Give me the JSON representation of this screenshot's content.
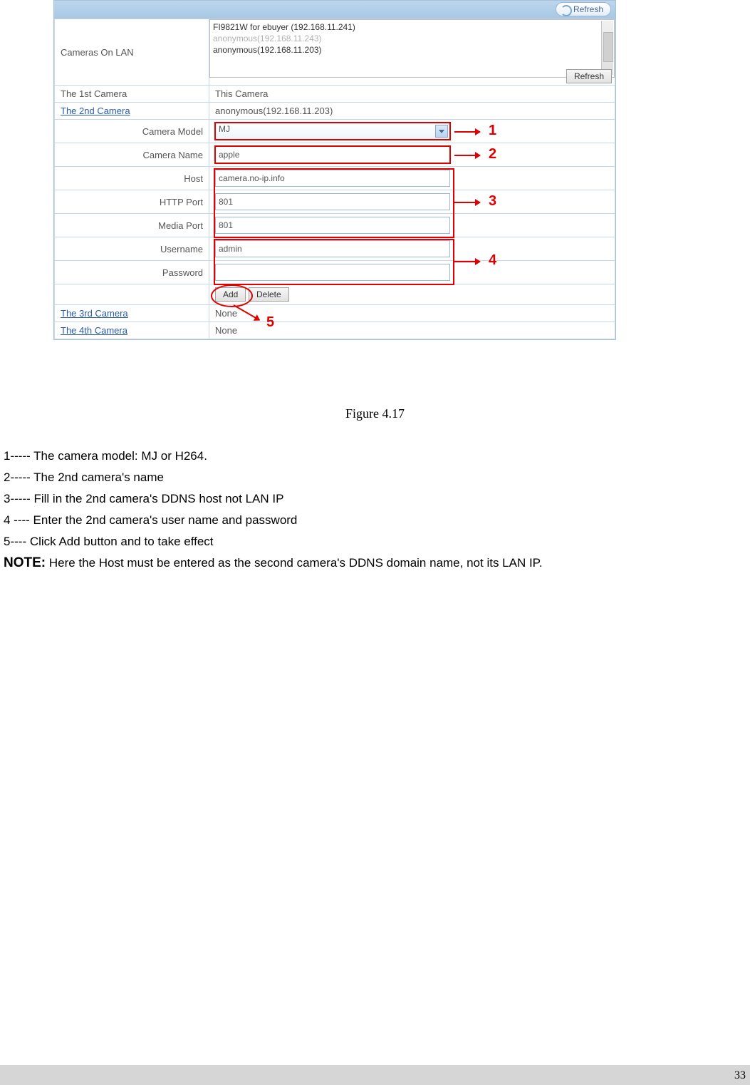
{
  "buttons": {
    "refresh_top": "Refresh",
    "refresh_inline": "Refresh",
    "add": "Add",
    "delete": "Delete"
  },
  "rows": {
    "cameras_on_lan": "Cameras On LAN",
    "first_cam_lbl": "The 1st Camera",
    "first_cam_val": "This Camera",
    "second_cam_lbl": "The 2nd Camera",
    "second_cam_val": "anonymous(192.168.11.203)",
    "third_cam_lbl": "The 3rd Camera",
    "third_cam_val": "None",
    "fourth_cam_lbl": "The 4th Camera",
    "fourth_cam_val": "None"
  },
  "cam_list": {
    "line1": "FI9821W for ebuyer (192.168.11.241)",
    "line2": "anonymous(192.168.11.243)",
    "line3": "anonymous(192.168.11.203)"
  },
  "form": {
    "camera_model_lbl": "Camera Model",
    "camera_model_val": "MJ",
    "camera_name_lbl": "Camera Name",
    "camera_name_val": "apple",
    "host_lbl": "Host",
    "host_val": "camera.no-ip.info",
    "http_port_lbl": "HTTP Port",
    "http_port_val": "801",
    "media_port_lbl": "Media Port",
    "media_port_val": "801",
    "username_lbl": "Username",
    "username_val": "admin",
    "password_lbl": "Password",
    "password_val": ""
  },
  "callouts": {
    "c1": "1",
    "c2": "2",
    "c3": "3",
    "c4": "4",
    "c5": "5"
  },
  "caption": "Figure 4.17",
  "legend": {
    "l1": "1----- The camera model: MJ or H264.",
    "l2": "2----- The 2nd camera's name",
    "l3": "3----- Fill in the 2nd camera's DDNS host not LAN IP",
    "l4": "4 ---- Enter the 2nd camera's user name and password",
    "l5": "5---- Click Add button and to take effect",
    "note_label": "NOTE:",
    "note_text": " Here the Host must be entered as the second camera's DDNS domain name, not its LAN IP."
  },
  "page_number": "33"
}
